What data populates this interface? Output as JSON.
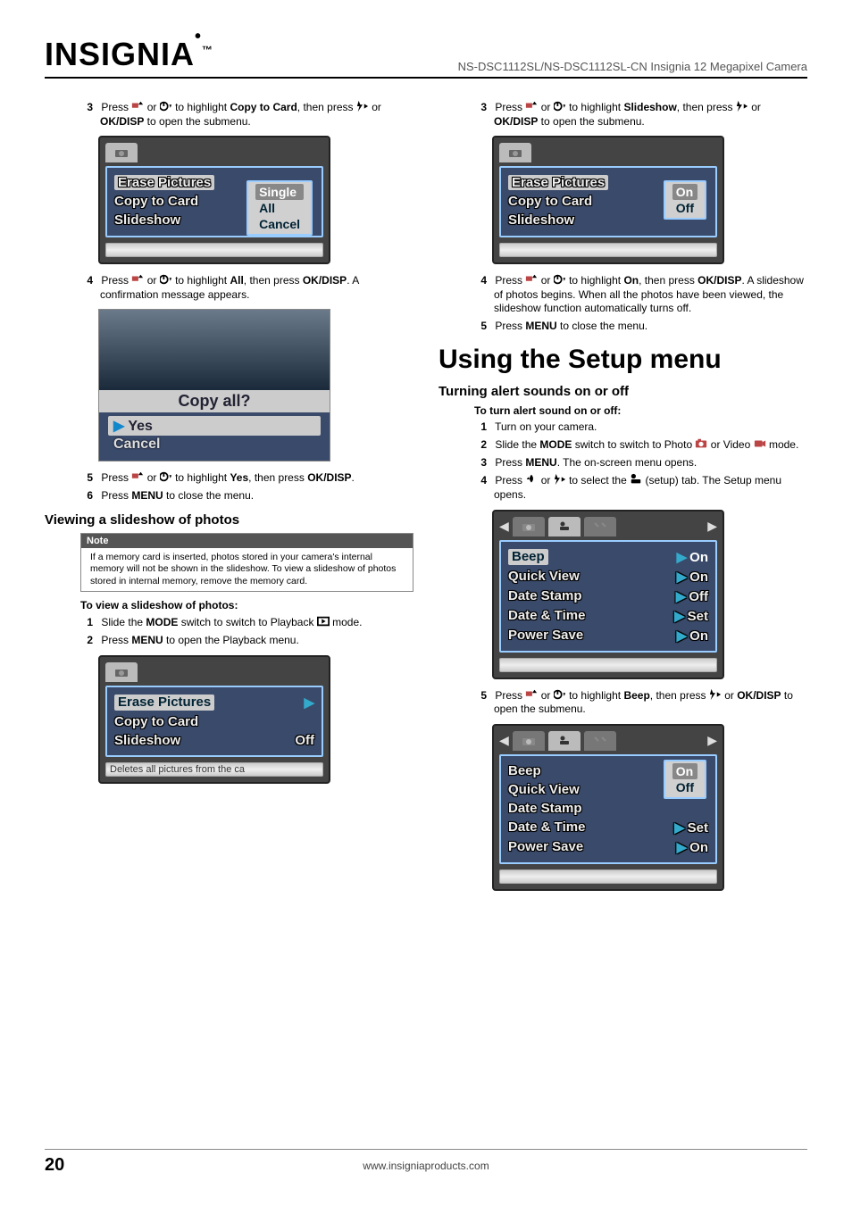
{
  "header": {
    "brand": "INSIGNIA",
    "product": "NS-DSC1112SL/NS-DSC1112SL-CN Insignia 12 Megapixel Camera"
  },
  "footer": {
    "page": "20",
    "url": "www.insigniaproducts.com"
  },
  "left": {
    "s3a": "Press ",
    "s3b": " or ",
    "s3c": " to highlight ",
    "s3_copy": "Copy to Card",
    "s3d": ", then press ",
    "s3e": " or ",
    "s3_okdisp": "OK/DISP",
    "s3f": " to open the submenu.",
    "s4a": "Press ",
    "s4b": " or ",
    "s4c": " to highlight ",
    "s4_all": "All",
    "s4d": ", then press ",
    "s4_okdisp": "OK/DISP",
    "s4e": ". A confirmation message appears.",
    "s5a": "Press ",
    "s5b": " or ",
    "s5c": " to highlight ",
    "s5_yes": "Yes",
    "s5d": ", then press ",
    "s5_okdisp": "OK/DISP",
    "s5e": ".",
    "s6a": "Press ",
    "s6_menu": "MENU",
    "s6b": " to close the menu.",
    "h3": "Viewing a slideshow of photos",
    "note_label": "Note",
    "note_text": "If a memory card is inserted, photos stored in your camera's internal memory will not be shown in the slideshow. To view a slideshow of photos stored in internal memory, remove the memory card.",
    "h4": "To view a slideshow of photos:",
    "v1a": "Slide the ",
    "v1_mode": "MODE",
    "v1b": " switch to switch to Playback ",
    "v1c": " mode.",
    "v2a": "Press ",
    "v2_menu": "MENU",
    "v2b": " to open the Playback menu.",
    "shot1": {
      "erase": "Erase Pictures",
      "copy": "Copy to Card",
      "slide": "Slideshow",
      "single": "Single",
      "all": "All",
      "cancel": "Cancel"
    },
    "confirm": {
      "title": "Copy all?",
      "yes": "Yes",
      "cancel": "Cancel"
    },
    "shot3": {
      "erase": "Erase Pictures",
      "copy": "Copy to Card",
      "slide": "Slideshow",
      "off": "Off",
      "status": "Deletes all pictures from the ca"
    }
  },
  "right": {
    "s3a": "Press ",
    "s3b": " or ",
    "s3c": " to highlight ",
    "s3_slide": "Slideshow",
    "s3d": ", then press ",
    "s3e": " or ",
    "s3_okdisp": "OK/DISP",
    "s3f": " to open the submenu.",
    "s4a": "Press ",
    "s4b": " or ",
    "s4c": " to highlight ",
    "s4_on": "On",
    "s4d": ", then press ",
    "s4_okdisp": "OK/DISP",
    "s4e": ". A slideshow of photos begins. When all the photos have been viewed, the slideshow function automatically turns off.",
    "s5a": "Press ",
    "s5_menu": "MENU",
    "s5b": " to close the menu.",
    "h2": "Using the Setup menu",
    "h3": "Turning alert sounds on or off",
    "h4": "To turn alert sound on or off:",
    "t1": "Turn on your camera.",
    "t2a": "Slide the ",
    "t2_mode": "MODE",
    "t2b": " switch to switch to Photo ",
    "t2c": " or Video ",
    "t2d": " mode.",
    "t3a": "Press ",
    "t3_menu": "MENU",
    "t3b": ". The on-screen menu opens.",
    "t4a": "Press ",
    "t4b": " or ",
    "t4c": " to select the ",
    "t4d": " (setup) tab. The Setup menu opens.",
    "t5a": "Press ",
    "t5b": " or ",
    "t5c": " to highlight ",
    "t5_beep": "Beep",
    "t5d": ", then press ",
    "t5e": " or ",
    "t5_okdisp": "OK/DISP",
    "t5f": " to open the submenu.",
    "shot1": {
      "erase": "Erase Pictures",
      "copy": "Copy to Card",
      "slide": "Slideshow",
      "on": "On",
      "off": "Off"
    },
    "setup1": {
      "beep": "Beep",
      "qv": "Quick View",
      "ds": "Date Stamp",
      "dt": "Date & Time",
      "ps": "Power Save",
      "on": "On",
      "off": "Off",
      "set": "Set"
    },
    "setup2": {
      "beep": "Beep",
      "qv": "Quick View",
      "ds": "Date Stamp",
      "dt": "Date & Time",
      "ps": "Power Save",
      "on": "On",
      "off": "Off",
      "set": "Set"
    }
  },
  "nums": {
    "n1": "1",
    "n2": "2",
    "n3": "3",
    "n4": "4",
    "n5": "5",
    "n6": "6"
  }
}
